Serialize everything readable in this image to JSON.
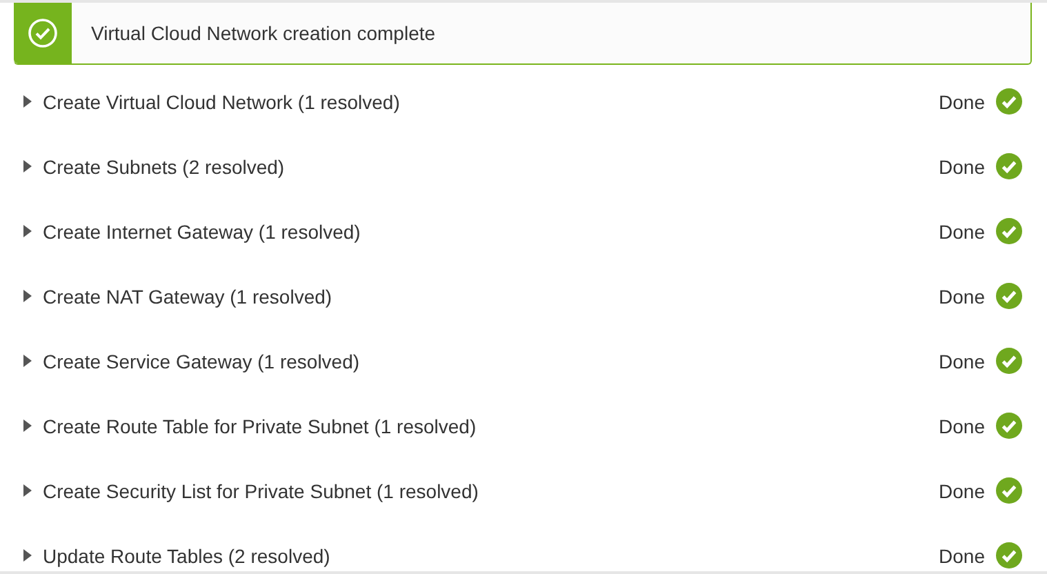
{
  "banner": {
    "message": "Virtual Cloud Network creation complete"
  },
  "steps": [
    {
      "label": "Create Virtual Cloud Network (1 resolved)",
      "expanded": false,
      "status": "Done",
      "kind": "done"
    },
    {
      "label": "Create Subnets (2 resolved)",
      "expanded": false,
      "status": "Done",
      "kind": "done"
    },
    {
      "label": "Create Internet Gateway (1 resolved)",
      "expanded": false,
      "status": "Done",
      "kind": "done"
    },
    {
      "label": "Create NAT Gateway (1 resolved)",
      "expanded": false,
      "status": "Done",
      "kind": "done"
    },
    {
      "label": "Create Service Gateway (1 resolved)",
      "expanded": false,
      "status": "Done",
      "kind": "done"
    },
    {
      "label": "Create Route Table for Private Subnet (1 resolved)",
      "expanded": false,
      "status": "Done",
      "kind": "done"
    },
    {
      "label": "Create Security List for Private Subnet (1 resolved)",
      "expanded": false,
      "status": "Done",
      "kind": "done"
    },
    {
      "label": "Update Route Tables (2 resolved)",
      "expanded": false,
      "status": "Done",
      "kind": "done"
    }
  ]
}
